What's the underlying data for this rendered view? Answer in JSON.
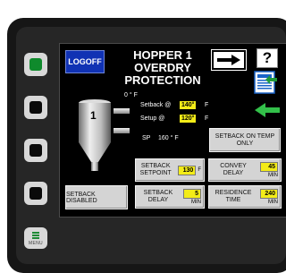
{
  "screen": {
    "title": [
      "HOPPER 1",
      "OVERDRY",
      "PROTECTION"
    ],
    "logoff_label": "LOGOFF",
    "help_label": "?",
    "hopper_number": "1",
    "temp_readout": "0 °  F",
    "setback_label": "Setback @",
    "setback_value": "140°",
    "setback_unit": "F",
    "setup_label": "Setup @",
    "setup_value": "120°",
    "setup_unit": "F",
    "sp_label": "SP",
    "sp_value": "160 ° F",
    "setback_on_temp_label": "SETBACK ON TEMP ONLY",
    "setback_disabled_label": "SETBACK DISABLED",
    "params": {
      "setback_setpoint": {
        "label": "SETBACK SETPOINT",
        "value": "130",
        "unit": "F"
      },
      "convey_delay": {
        "label": "CONVEY DELAY",
        "value": "45",
        "unit": "MIN"
      },
      "setback_delay": {
        "label": "SETBACK DELAY",
        "value": "5",
        "unit": "MIN"
      },
      "residence_time": {
        "label": "RESIDENCE TIME",
        "value": "240",
        "unit": "MIN"
      }
    }
  },
  "bezel": {
    "menu_label": "MENU"
  },
  "colors": {
    "screen_bg": "#000000",
    "logoff_blue": "#1032b4",
    "value_yellow": "#f3ec18",
    "back_arrow_green": "#33c04a",
    "active_key_green": "#0f8a2c"
  }
}
